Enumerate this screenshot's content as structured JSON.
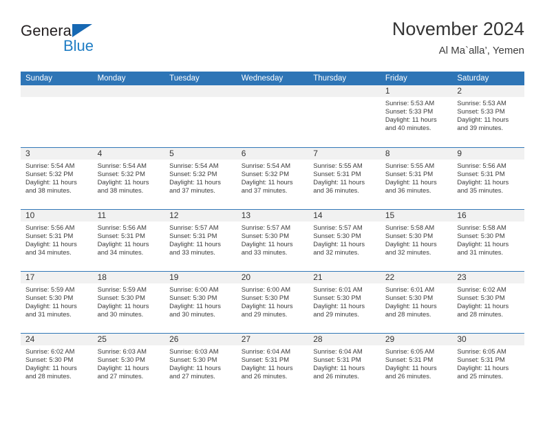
{
  "brand": {
    "name_part1": "General",
    "name_part2": "Blue",
    "triangle_icon": "blue-triangle-logo-mark",
    "color_dark": "#231f20",
    "color_blue": "#1f7dc4"
  },
  "header": {
    "title": "November 2024",
    "location": "Al Ma`alla’, Yemen"
  },
  "theme": {
    "header_row_bg": "#2e75b6",
    "daynum_bg": "#f1f1f1",
    "row_divider": "#2e75b6",
    "page_bg": "#ffffff",
    "text": "#3a3a3a"
  },
  "labels": {
    "sunrise_prefix": "Sunrise:",
    "sunset_prefix": "Sunset:",
    "daylight_prefix": "Daylight:"
  },
  "weekdays": [
    "Sunday",
    "Monday",
    "Tuesday",
    "Wednesday",
    "Thursday",
    "Friday",
    "Saturday"
  ],
  "weeks": [
    [
      {
        "day": "",
        "sunrise": "",
        "sunset": "",
        "daylight_line1": "",
        "daylight_line2": ""
      },
      {
        "day": "",
        "sunrise": "",
        "sunset": "",
        "daylight_line1": "",
        "daylight_line2": ""
      },
      {
        "day": "",
        "sunrise": "",
        "sunset": "",
        "daylight_line1": "",
        "daylight_line2": ""
      },
      {
        "day": "",
        "sunrise": "",
        "sunset": "",
        "daylight_line1": "",
        "daylight_line2": ""
      },
      {
        "day": "",
        "sunrise": "",
        "sunset": "",
        "daylight_line1": "",
        "daylight_line2": ""
      },
      {
        "day": "1",
        "sunrise": "Sunrise: 5:53 AM",
        "sunset": "Sunset: 5:33 PM",
        "daylight_line1": "Daylight: 11 hours",
        "daylight_line2": "and 40 minutes."
      },
      {
        "day": "2",
        "sunrise": "Sunrise: 5:53 AM",
        "sunset": "Sunset: 5:33 PM",
        "daylight_line1": "Daylight: 11 hours",
        "daylight_line2": "and 39 minutes."
      }
    ],
    [
      {
        "day": "3",
        "sunrise": "Sunrise: 5:54 AM",
        "sunset": "Sunset: 5:32 PM",
        "daylight_line1": "Daylight: 11 hours",
        "daylight_line2": "and 38 minutes."
      },
      {
        "day": "4",
        "sunrise": "Sunrise: 5:54 AM",
        "sunset": "Sunset: 5:32 PM",
        "daylight_line1": "Daylight: 11 hours",
        "daylight_line2": "and 38 minutes."
      },
      {
        "day": "5",
        "sunrise": "Sunrise: 5:54 AM",
        "sunset": "Sunset: 5:32 PM",
        "daylight_line1": "Daylight: 11 hours",
        "daylight_line2": "and 37 minutes."
      },
      {
        "day": "6",
        "sunrise": "Sunrise: 5:54 AM",
        "sunset": "Sunset: 5:32 PM",
        "daylight_line1": "Daylight: 11 hours",
        "daylight_line2": "and 37 minutes."
      },
      {
        "day": "7",
        "sunrise": "Sunrise: 5:55 AM",
        "sunset": "Sunset: 5:31 PM",
        "daylight_line1": "Daylight: 11 hours",
        "daylight_line2": "and 36 minutes."
      },
      {
        "day": "8",
        "sunrise": "Sunrise: 5:55 AM",
        "sunset": "Sunset: 5:31 PM",
        "daylight_line1": "Daylight: 11 hours",
        "daylight_line2": "and 36 minutes."
      },
      {
        "day": "9",
        "sunrise": "Sunrise: 5:56 AM",
        "sunset": "Sunset: 5:31 PM",
        "daylight_line1": "Daylight: 11 hours",
        "daylight_line2": "and 35 minutes."
      }
    ],
    [
      {
        "day": "10",
        "sunrise": "Sunrise: 5:56 AM",
        "sunset": "Sunset: 5:31 PM",
        "daylight_line1": "Daylight: 11 hours",
        "daylight_line2": "and 34 minutes."
      },
      {
        "day": "11",
        "sunrise": "Sunrise: 5:56 AM",
        "sunset": "Sunset: 5:31 PM",
        "daylight_line1": "Daylight: 11 hours",
        "daylight_line2": "and 34 minutes."
      },
      {
        "day": "12",
        "sunrise": "Sunrise: 5:57 AM",
        "sunset": "Sunset: 5:31 PM",
        "daylight_line1": "Daylight: 11 hours",
        "daylight_line2": "and 33 minutes."
      },
      {
        "day": "13",
        "sunrise": "Sunrise: 5:57 AM",
        "sunset": "Sunset: 5:30 PM",
        "daylight_line1": "Daylight: 11 hours",
        "daylight_line2": "and 33 minutes."
      },
      {
        "day": "14",
        "sunrise": "Sunrise: 5:57 AM",
        "sunset": "Sunset: 5:30 PM",
        "daylight_line1": "Daylight: 11 hours",
        "daylight_line2": "and 32 minutes."
      },
      {
        "day": "15",
        "sunrise": "Sunrise: 5:58 AM",
        "sunset": "Sunset: 5:30 PM",
        "daylight_line1": "Daylight: 11 hours",
        "daylight_line2": "and 32 minutes."
      },
      {
        "day": "16",
        "sunrise": "Sunrise: 5:58 AM",
        "sunset": "Sunset: 5:30 PM",
        "daylight_line1": "Daylight: 11 hours",
        "daylight_line2": "and 31 minutes."
      }
    ],
    [
      {
        "day": "17",
        "sunrise": "Sunrise: 5:59 AM",
        "sunset": "Sunset: 5:30 PM",
        "daylight_line1": "Daylight: 11 hours",
        "daylight_line2": "and 31 minutes."
      },
      {
        "day": "18",
        "sunrise": "Sunrise: 5:59 AM",
        "sunset": "Sunset: 5:30 PM",
        "daylight_line1": "Daylight: 11 hours",
        "daylight_line2": "and 30 minutes."
      },
      {
        "day": "19",
        "sunrise": "Sunrise: 6:00 AM",
        "sunset": "Sunset: 5:30 PM",
        "daylight_line1": "Daylight: 11 hours",
        "daylight_line2": "and 30 minutes."
      },
      {
        "day": "20",
        "sunrise": "Sunrise: 6:00 AM",
        "sunset": "Sunset: 5:30 PM",
        "daylight_line1": "Daylight: 11 hours",
        "daylight_line2": "and 29 minutes."
      },
      {
        "day": "21",
        "sunrise": "Sunrise: 6:01 AM",
        "sunset": "Sunset: 5:30 PM",
        "daylight_line1": "Daylight: 11 hours",
        "daylight_line2": "and 29 minutes."
      },
      {
        "day": "22",
        "sunrise": "Sunrise: 6:01 AM",
        "sunset": "Sunset: 5:30 PM",
        "daylight_line1": "Daylight: 11 hours",
        "daylight_line2": "and 28 minutes."
      },
      {
        "day": "23",
        "sunrise": "Sunrise: 6:02 AM",
        "sunset": "Sunset: 5:30 PM",
        "daylight_line1": "Daylight: 11 hours",
        "daylight_line2": "and 28 minutes."
      }
    ],
    [
      {
        "day": "24",
        "sunrise": "Sunrise: 6:02 AM",
        "sunset": "Sunset: 5:30 PM",
        "daylight_line1": "Daylight: 11 hours",
        "daylight_line2": "and 28 minutes."
      },
      {
        "day": "25",
        "sunrise": "Sunrise: 6:03 AM",
        "sunset": "Sunset: 5:30 PM",
        "daylight_line1": "Daylight: 11 hours",
        "daylight_line2": "and 27 minutes."
      },
      {
        "day": "26",
        "sunrise": "Sunrise: 6:03 AM",
        "sunset": "Sunset: 5:30 PM",
        "daylight_line1": "Daylight: 11 hours",
        "daylight_line2": "and 27 minutes."
      },
      {
        "day": "27",
        "sunrise": "Sunrise: 6:04 AM",
        "sunset": "Sunset: 5:31 PM",
        "daylight_line1": "Daylight: 11 hours",
        "daylight_line2": "and 26 minutes."
      },
      {
        "day": "28",
        "sunrise": "Sunrise: 6:04 AM",
        "sunset": "Sunset: 5:31 PM",
        "daylight_line1": "Daylight: 11 hours",
        "daylight_line2": "and 26 minutes."
      },
      {
        "day": "29",
        "sunrise": "Sunrise: 6:05 AM",
        "sunset": "Sunset: 5:31 PM",
        "daylight_line1": "Daylight: 11 hours",
        "daylight_line2": "and 26 minutes."
      },
      {
        "day": "30",
        "sunrise": "Sunrise: 6:05 AM",
        "sunset": "Sunset: 5:31 PM",
        "daylight_line1": "Daylight: 11 hours",
        "daylight_line2": "and 25 minutes."
      }
    ]
  ]
}
